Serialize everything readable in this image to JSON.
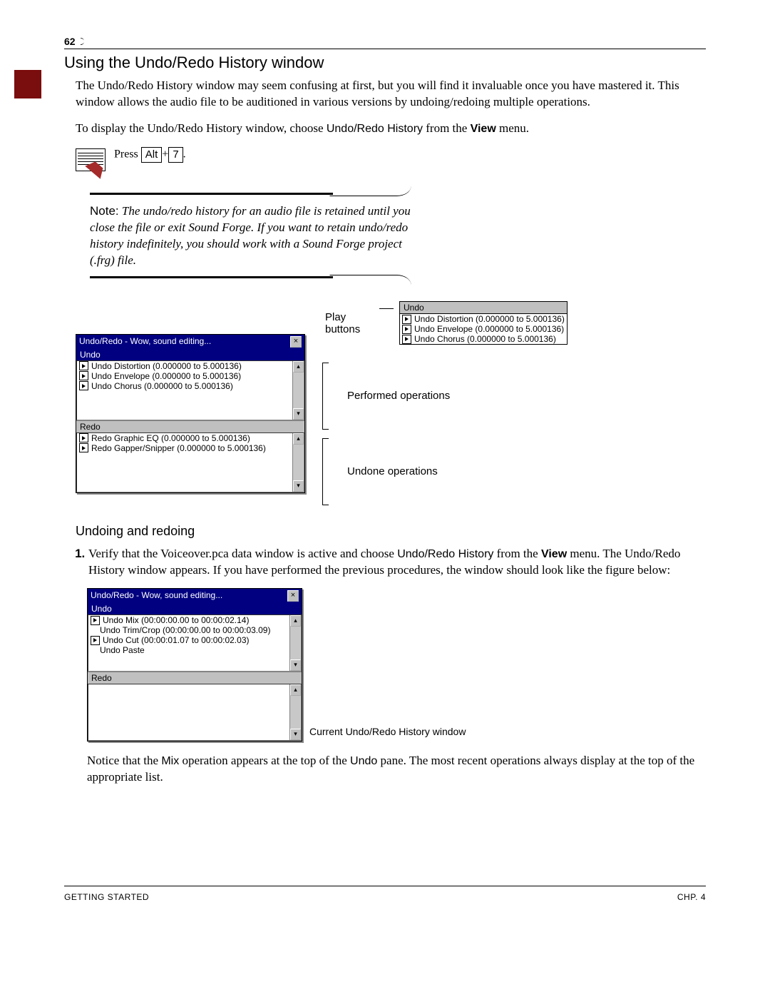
{
  "pageNumber": "62",
  "heading": "Using the Undo/Redo History window",
  "paragraph1": "The Undo/Redo History window may seem confusing at first, but you will find it invaluable once you have mastered it. This window allows the audio file to be auditioned in various versions by undoing/redoing multiple operations.",
  "paragraph2_pre": "To display the Undo/Redo History window, choose ",
  "paragraph2_cmd": "Undo/Redo History",
  "paragraph2_mid": " from the ",
  "paragraph2_menu": "View",
  "paragraph2_post": " menu.",
  "press_label": "Press ",
  "key_alt": "Alt",
  "key_plus": "+",
  "key_7": "7",
  "key_end": ".",
  "note_label": "Note:",
  "note_body": " The undo/redo history for an audio file is retained until you close the file or exit Sound Forge. If you want to retain undo/redo history indefinitely, you should work with a Sound Forge project (.frg) file.",
  "win1": {
    "title": "Undo/Redo - Wow, sound editing...",
    "undo_hdr": "Undo",
    "undo_items": [
      "Undo Distortion (0.000000 to 5.000136)",
      "Undo Envelope (0.000000 to 5.000136)",
      "Undo Chorus (0.000000 to 5.000136)"
    ],
    "redo_hdr": "Redo",
    "redo_items": [
      "Redo Graphic EQ (0.000000 to 5.000136)",
      "Redo Gapper/Snipper (0.000000 to 5.000136)"
    ]
  },
  "callouts": {
    "play": "Play buttons",
    "performed": "Performed operations",
    "undone": "Undone operations"
  },
  "zoom": {
    "hdr": "Undo",
    "items": [
      "Undo Distortion (0.000000 to 5.000136)",
      "Undo Envelope (0.000000 to 5.000136)",
      "Undo Chorus (0.000000 to 5.000136)"
    ]
  },
  "subheading": "Undoing and redoing",
  "step1_pre": "Verify that the Voiceover.pca data window is active and choose ",
  "step1_cmd": "Undo/Redo History",
  "step1_mid": " from the ",
  "step1_menu": "View",
  "step1_post": " menu. The Undo/Redo History window appears. If you have performed the previous procedures, the window should look like the figure below:",
  "win2": {
    "title": "Undo/Redo - Wow, sound editing...",
    "undo_hdr": "Undo",
    "undo_items": [
      "Undo Mix (00:00:00.00 to 00:00:02.14)",
      "Undo Trim/Crop (00:00:00.00 to 00:00:03.09)",
      "Undo Cut (00:00:01.07 to 00:00:02.03)",
      "Undo Paste"
    ],
    "redo_hdr": "Redo"
  },
  "fig2_caption": "Current Undo/Redo History window",
  "paragraph3_pre": "Notice that the ",
  "paragraph3_mix": "Mix",
  "paragraph3_mid": " operation appears at the top of the ",
  "paragraph3_undo": "Undo",
  "paragraph3_post": " pane. The most recent operations always display at the top of the appropriate list.",
  "footer_left": "GETTING STARTED",
  "footer_right": "CHP. 4"
}
